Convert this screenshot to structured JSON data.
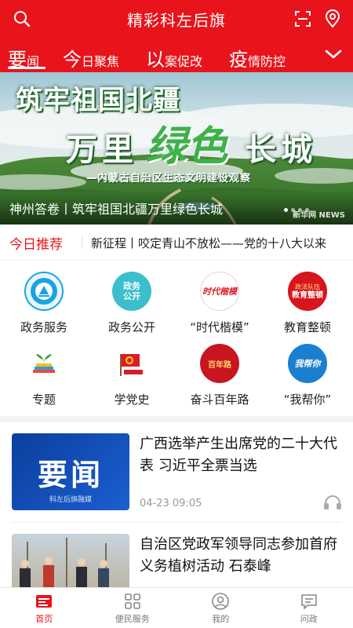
{
  "header": {
    "title": "精彩科左后旗",
    "tabs": [
      {
        "big": "要",
        "rest": "闻"
      },
      {
        "big": "今",
        "rest": "日聚焦"
      },
      {
        "big": "以",
        "rest": "案促改"
      },
      {
        "big": "疫",
        "rest": "情防控"
      }
    ]
  },
  "banner": {
    "headline_line1": "筑牢祖国北疆",
    "headline_line2_left": "万里",
    "headline_green": "绿色",
    "headline_line2_right": "长城",
    "subtitle": "—内蒙古自治区生态文明建设观察",
    "caption": "神州答卷丨筑牢祖国北疆万里绿色长城",
    "watermark": "新华网 NEWS"
  },
  "recommend": {
    "label": "今日推荐",
    "text": "新征程丨咬定青山不放松——党的十八大以来"
  },
  "grid": [
    {
      "label": "政务服务",
      "icon": "gov-service-icon",
      "color": "#1aa3e0"
    },
    {
      "label": "政务公开",
      "icon": "gov-open-icon",
      "color": "#2cb6c4",
      "badge": [
        "政务",
        "公开"
      ]
    },
    {
      "label": "“时代楷模”",
      "icon": "role-model-icon",
      "color": "#d81e28",
      "badge": [
        "时代楷模"
      ]
    },
    {
      "label": "教育整顿",
      "icon": "education-icon",
      "color": "#d8141c",
      "badge": [
        "政法队伍",
        "教育整顿"
      ]
    },
    {
      "label": "专题",
      "icon": "topic-icon",
      "color": "#3b9c45"
    },
    {
      "label": "学党史",
      "icon": "party-history-icon",
      "color": "#d81e28"
    },
    {
      "label": "奋斗百年路",
      "icon": "century-road-icon",
      "color": "#c81620",
      "badge": [
        "百年路"
      ]
    },
    {
      "label": "“我帮你”",
      "icon": "help-you-icon",
      "color": "#1b7fd0",
      "badge": [
        "我帮你"
      ]
    }
  ],
  "news": [
    {
      "title": "广西选举产生出席党的二十大代表 习近平全票当选",
      "time": "04-23 09:05",
      "thumb_text": "要闻",
      "thumb_caption": "科左后旗融媒"
    },
    {
      "title": "自治区党政军领导同志参加首府义务植树活动 石泰峰",
      "time": ""
    }
  ],
  "bottom_nav": [
    {
      "label": "首页",
      "icon": "home-icon",
      "active": true
    },
    {
      "label": "便民服务",
      "icon": "services-grid-icon",
      "active": false
    },
    {
      "label": "我的",
      "icon": "profile-icon",
      "active": false
    },
    {
      "label": "问政",
      "icon": "inquiry-icon",
      "active": false
    }
  ],
  "colors": {
    "brand": "#e8131b"
  }
}
